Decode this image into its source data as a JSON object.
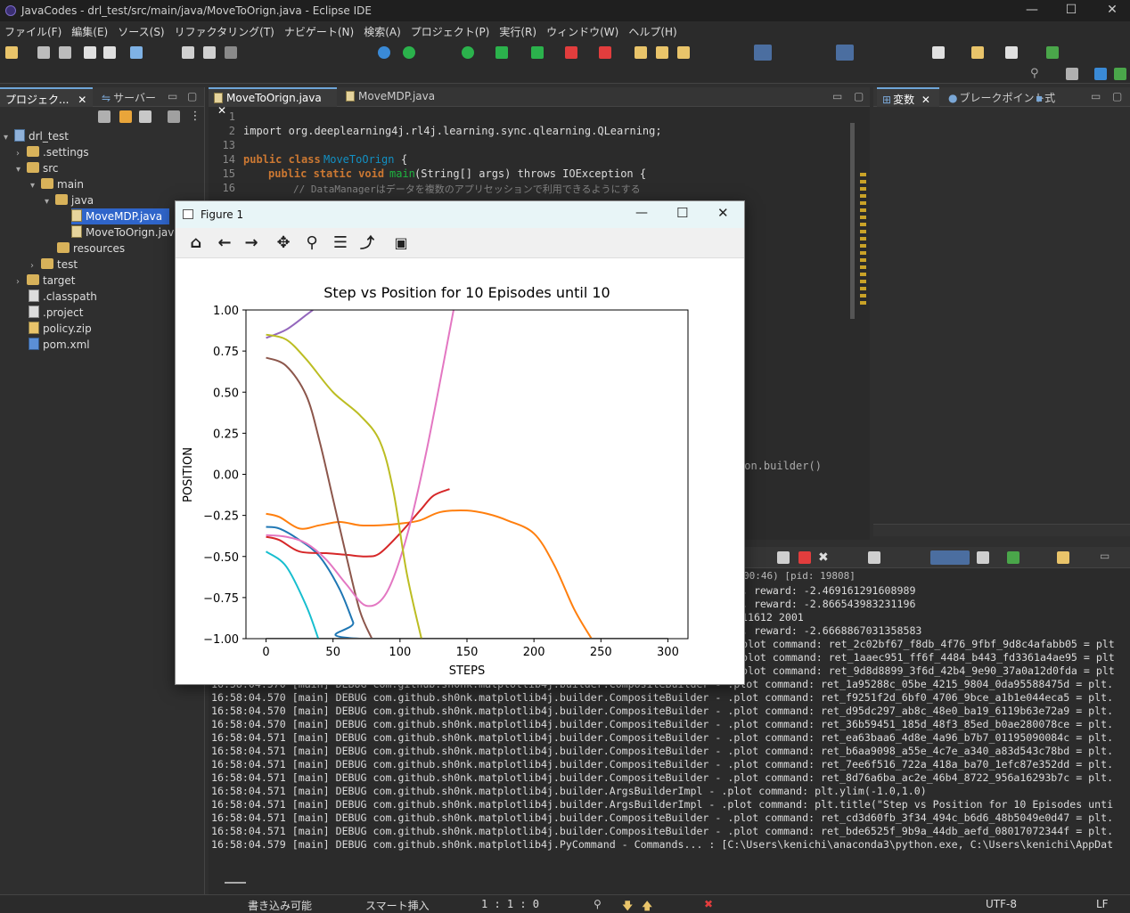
{
  "window": {
    "title": "JavaCodes - drl_test/src/main/java/MoveToOrign.java - Eclipse IDE"
  },
  "menu": [
    "ファイル(F)",
    "編集(E)",
    "ソース(S)",
    "リファクタリング(T)",
    "ナビゲート(N)",
    "検索(A)",
    "プロジェクト(P)",
    "実行(R)",
    "ウィンドウ(W)",
    "ヘルプ(H)"
  ],
  "left_panel": {
    "tab_project": "プロジェク...",
    "tab_server": "サーバー",
    "tree": [
      {
        "label": "drl_test",
        "kind": "project"
      },
      {
        "label": ".settings",
        "kind": "folder"
      },
      {
        "label": "src",
        "kind": "folder"
      },
      {
        "label": "main",
        "kind": "folder"
      },
      {
        "label": "java",
        "kind": "folder"
      },
      {
        "label": "MoveMDP.java",
        "kind": "java"
      },
      {
        "label": "MoveToOrign.java",
        "kind": "java"
      },
      {
        "label": "resources",
        "kind": "folder"
      },
      {
        "label": "test",
        "kind": "folder"
      },
      {
        "label": "target",
        "kind": "folder"
      },
      {
        "label": ".classpath",
        "kind": "file"
      },
      {
        "label": ".project",
        "kind": "file"
      },
      {
        "label": "policy.zip",
        "kind": "file"
      },
      {
        "label": "pom.xml",
        "kind": "file"
      }
    ]
  },
  "editor": {
    "tab_active": "MoveToOrign.java",
    "tab_other": "MoveMDP.java",
    "line_numbers": [
      "1",
      "2",
      "13",
      "14",
      "15",
      "16"
    ],
    "import_line": "import org.deeplearning4j.rl4j.learning.sync.qlearning.QLearning;",
    "class_kw": "public class",
    "class_name": "MoveToOrign",
    "method_kw": "public static void",
    "method_name": "main",
    "method_params": "(String[] args) throws IOException {",
    "comment": "// DataManagerはデータを複数のアプリセッションで利用できるようにする",
    "builder_text": "ion.builder()"
  },
  "right_panel": {
    "tab_vars": "変数",
    "tab_breakpoints": "ブレークポイント",
    "tab_expr": "式"
  },
  "console": {
    "header": "00:46) [pid: 19808]",
    "lines": [
      "7, reward: -2.469161291608989",
      "3, reward: -2.866543983231196",
      "011612 2001",
      "9, reward: -2.6668867031358583",
      ".plot command: ret_2c02bf67_f8db_4f76_9fbf_9d8c4afabb05 = plt.",
      ".plot command: ret_1aaec951_ff6f_4484_b443_fd3361a4ae95 = plt.",
      ".plot command: ret_9d8d8899_3f6d_42b4_9e90_37a0a12d0fda = plt.",
      "16:58:04.570 [main] DEBUG com.github.sh0nk.matplotlib4j.builder.CompositeBuilder - .plot command: ret_1a95288c_05be_4215_9804_0da95588475d = plt.",
      "16:58:04.570 [main] DEBUG com.github.sh0nk.matplotlib4j.builder.CompositeBuilder - .plot command: ret_f9251f2d_6bf0_4706_9bce_a1b1e044eca5 = plt.",
      "16:58:04.570 [main] DEBUG com.github.sh0nk.matplotlib4j.builder.CompositeBuilder - .plot command: ret_d95dc297_ab8c_48e0_ba19_6119b63e72a9 = plt.",
      "16:58:04.570 [main] DEBUG com.github.sh0nk.matplotlib4j.builder.CompositeBuilder - .plot command: ret_36b59451_185d_48f3_85ed_b0ae280078ce = plt.",
      "16:58:04.571 [main] DEBUG com.github.sh0nk.matplotlib4j.builder.CompositeBuilder - .plot command: ret_ea63baa6_4d8e_4a96_b7b7_01195090084c = plt.",
      "16:58:04.571 [main] DEBUG com.github.sh0nk.matplotlib4j.builder.CompositeBuilder - .plot command: ret_b6aa9098_a55e_4c7e_a340_a83d543c78bd = plt.",
      "16:58:04.571 [main] DEBUG com.github.sh0nk.matplotlib4j.builder.CompositeBuilder - .plot command: ret_7ee6f516_722a_418a_ba70_1efc87e352dd = plt.",
      "16:58:04.571 [main] DEBUG com.github.sh0nk.matplotlib4j.builder.CompositeBuilder - .plot command: ret_8d76a6ba_ac2e_46b4_8722_956a16293b7c = plt.",
      "16:58:04.571 [main] DEBUG com.github.sh0nk.matplotlib4j.builder.ArgsBuilderImpl - .plot command: plt.ylim(-1.0,1.0)",
      "16:58:04.571 [main] DEBUG com.github.sh0nk.matplotlib4j.builder.ArgsBuilderImpl - .plot command: plt.title(\"Step vs Position for 10 Episodes unti",
      "16:58:04.571 [main] DEBUG com.github.sh0nk.matplotlib4j.builder.CompositeBuilder - .plot command: ret_cd3d60fb_3f34_494c_b6d6_48b5049e0d47 = plt.",
      "16:58:04.571 [main] DEBUG com.github.sh0nk.matplotlib4j.builder.CompositeBuilder - .plot command: ret_bde6525f_9b9a_44db_aefd_08017072344f = plt.",
      "16:58:04.579 [main] DEBUG com.github.sh0nk.matplotlib4j.PyCommand - Commands... : [C:\\Users\\kenichi\\anaconda3\\python.exe, C:\\Users\\kenichi\\AppDat"
    ]
  },
  "status": {
    "writable": "書き込み可能",
    "insert": "スマート挿入",
    "position": "1 : 1 : 0",
    "encoding": "UTF-8",
    "eol": "LF"
  },
  "figure": {
    "title": "Figure 1"
  },
  "chart_data": {
    "type": "line",
    "title": "Step vs Position for 10 Episodes until 10",
    "xlabel": "STEPS",
    "ylabel": "POSITION",
    "xlim": [
      -15,
      315
    ],
    "ylim": [
      -1.0,
      1.0
    ],
    "xticks": [
      0,
      50,
      100,
      150,
      200,
      250,
      300
    ],
    "yticks": [
      1.0,
      0.75,
      0.5,
      0.25,
      0.0,
      -0.25,
      -0.5,
      -0.75,
      -1.0
    ],
    "xtick_labels": [
      "0",
      "50",
      "100",
      "150",
      "200",
      "250",
      "300"
    ],
    "ytick_labels": [
      "1.00",
      "0.75",
      "0.50",
      "0.25",
      "0.00",
      "−0.25",
      "−0.50",
      "−0.75",
      "−1.00"
    ],
    "series": [
      {
        "color": "#1f77b4",
        "x": [
          0,
          10,
          25,
          40,
          55,
          65,
          70,
          300
        ],
        "y": [
          -0.32,
          -0.33,
          -0.4,
          -0.5,
          -0.7,
          -0.9,
          -1.0,
          -1.0
        ]
      },
      {
        "color": "#ff7f0e",
        "x": [
          0,
          10,
          25,
          40,
          55,
          70,
          85,
          100,
          115,
          130,
          150,
          165,
          180,
          200,
          215,
          230,
          243
        ],
        "y": [
          -0.24,
          -0.26,
          -0.33,
          -0.31,
          -0.29,
          -0.31,
          -0.31,
          -0.3,
          -0.28,
          -0.23,
          -0.22,
          -0.24,
          -0.28,
          -0.36,
          -0.55,
          -0.82,
          -1.0
        ]
      },
      {
        "color": "#2ca02c",
        "x": [
          0,
          300
        ],
        "y": [
          -1.0,
          -1.0
        ]
      },
      {
        "color": "#d62728",
        "x": [
          0,
          10,
          25,
          45,
          60,
          75,
          85,
          100,
          115,
          125,
          137
        ],
        "y": [
          -0.38,
          -0.4,
          -0.47,
          -0.48,
          -0.49,
          -0.5,
          -0.48,
          -0.36,
          -0.22,
          -0.13,
          -0.09
        ]
      },
      {
        "color": "#9467bd",
        "x": [
          0,
          15,
          30,
          35
        ],
        "y": [
          0.83,
          0.88,
          0.97,
          1.0
        ]
      },
      {
        "color": "#8c564b",
        "x": [
          0,
          15,
          30,
          40,
          50,
          60,
          70,
          79
        ],
        "y": [
          0.71,
          0.66,
          0.48,
          0.2,
          -0.15,
          -0.5,
          -0.83,
          -1.0
        ]
      },
      {
        "color": "#e377c2",
        "x": [
          0,
          15,
          30,
          45,
          60,
          75,
          90,
          105,
          120,
          140
        ],
        "y": [
          -0.37,
          -0.38,
          -0.42,
          -0.52,
          -0.67,
          -0.8,
          -0.72,
          -0.38,
          0.15,
          1.0
        ]
      },
      {
        "color": "#7f7f7f",
        "x": [
          0,
          300
        ],
        "y": [
          -1.0,
          -1.0
        ]
      },
      {
        "color": "#bcbd22",
        "x": [
          0,
          15,
          30,
          50,
          70,
          85,
          95,
          105,
          116
        ],
        "y": [
          0.85,
          0.82,
          0.7,
          0.5,
          0.36,
          0.2,
          -0.1,
          -0.6,
          -1.0
        ]
      },
      {
        "color": "#17becf",
        "x": [
          0,
          15,
          30,
          39
        ],
        "y": [
          -0.47,
          -0.56,
          -0.8,
          -1.0
        ]
      }
    ]
  }
}
